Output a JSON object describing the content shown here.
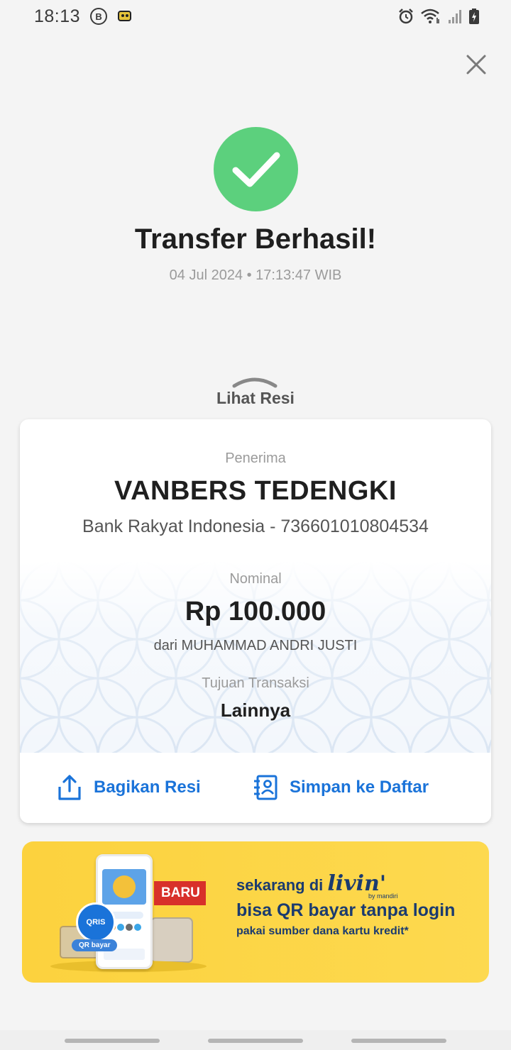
{
  "status": {
    "time": "18:13",
    "b_icon_letter": "B"
  },
  "header": {
    "title": "Transfer Berhasil!",
    "datetime": "04 Jul 2024 • 17:13:47 WIB"
  },
  "receipt_toggle": {
    "label": "Lihat Resi"
  },
  "receipt": {
    "recipient_label": "Penerima",
    "recipient_name": "VANBERS TEDENGKI",
    "recipient_bank": "Bank Rakyat Indonesia - 736601010804534",
    "amount_label": "Nominal",
    "amount": "Rp 100.000",
    "from": "dari MUHAMMAD ANDRI JUSTI",
    "purpose_label": "Tujuan Transaksi",
    "purpose": "Lainnya"
  },
  "actions": {
    "share_label": "Bagikan Resi",
    "save_label": "Simpan ke Daftar"
  },
  "banner": {
    "line1_prefix": "sekarang di",
    "livin": "livin'",
    "by_mandiri": "by mandiri",
    "line2": "bisa QR bayar tanpa login",
    "line3": "pakai sumber dana kartu kredit*",
    "badge": "BARU",
    "qris": "QRIS",
    "qr_label": "QR bayar"
  },
  "colors": {
    "accent": "#1a73d9",
    "success": "#5cd07d",
    "banner_bg": "#fcd23e",
    "banner_text": "#1b3b6f",
    "badge": "#d8302a"
  }
}
